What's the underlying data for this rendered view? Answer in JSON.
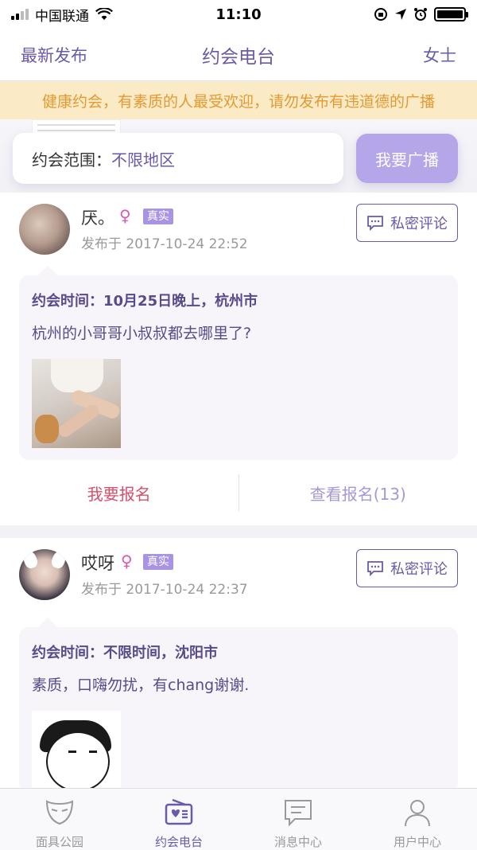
{
  "status_bar": {
    "carrier": "中国联通",
    "time": "11:10"
  },
  "nav": {
    "left": "最新发布",
    "title": "约会电台",
    "right": "女士"
  },
  "notice": "健康约会，有素质的人最受欢迎，请勿发布有违道德的广播",
  "filter": {
    "label": "约会范围：",
    "value": "不限地区",
    "broadcast_button": "我要广播"
  },
  "posts": [
    {
      "username": "厌。",
      "gender_symbol": "♀",
      "badge": "真实",
      "time": "发布于 2017-10-24 22:52",
      "comment_button": "私密评论",
      "date_info": "约会时间：10月25日晚上，杭州市",
      "text": "杭州的小哥哥小叔叔都去哪里了?",
      "signup_button": "我要报名",
      "view_signups": "查看报名(13)"
    },
    {
      "username": "哎呀",
      "gender_symbol": "♀",
      "badge": "真实",
      "time": "发布于 2017-10-24 22:37",
      "comment_button": "私密评论",
      "date_info": "约会时间：不限时间，沈阳市",
      "text": "素质，口嗨勿扰，有chang谢谢."
    }
  ],
  "tabs": [
    {
      "label": "面具公园",
      "icon": "mask-icon",
      "active": false
    },
    {
      "label": "约会电台",
      "icon": "radio-icon",
      "active": true
    },
    {
      "label": "消息中心",
      "icon": "message-icon",
      "active": false
    },
    {
      "label": "用户中心",
      "icon": "user-icon",
      "active": false
    }
  ],
  "colors": {
    "accent": "#6b5aa8",
    "notice_bg": "#fbeac6",
    "notice_text": "#e39a33",
    "signup": "#d74f6b"
  }
}
